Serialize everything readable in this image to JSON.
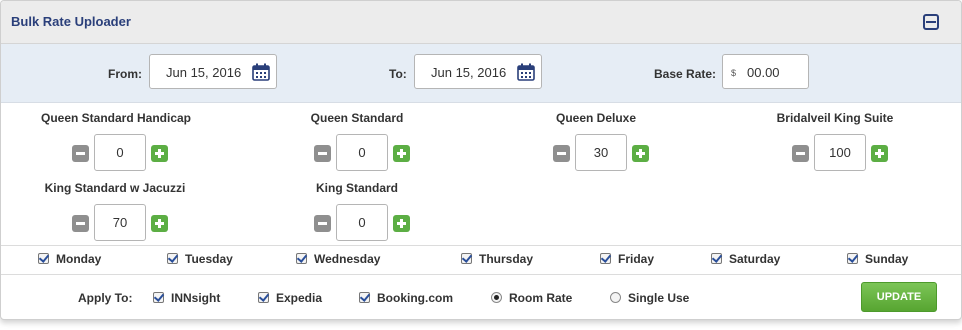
{
  "header": {
    "title": "Bulk Rate Uploader",
    "collapse_icon": "collapse-icon"
  },
  "dates": {
    "from_label": "From:",
    "from_value": "Jun 15, 2016",
    "to_label": "To:",
    "to_value": "Jun 15, 2016",
    "base_rate_label": "Base Rate:",
    "currency": "$",
    "base_rate_value": "00.00",
    "calendar_icon": "calendar-icon"
  },
  "rooms": [
    {
      "label": "Queen Standard Handicap",
      "value": "0"
    },
    {
      "label": "Queen Standard",
      "value": "0"
    },
    {
      "label": "Queen Deluxe",
      "value": "30"
    },
    {
      "label": "Bridalveil King Suite",
      "value": "100"
    },
    {
      "label": "King Standard w Jacuzzi",
      "value": "70"
    },
    {
      "label": "King Standard",
      "value": "0"
    }
  ],
  "days": [
    {
      "label": "Monday",
      "checked": true
    },
    {
      "label": "Tuesday",
      "checked": true
    },
    {
      "label": "Wednesday",
      "checked": true
    },
    {
      "label": "Thursday",
      "checked": true
    },
    {
      "label": "Friday",
      "checked": true
    },
    {
      "label": "Saturday",
      "checked": true
    },
    {
      "label": "Sunday",
      "checked": true
    }
  ],
  "apply": {
    "label": "Apply To:",
    "channels": [
      {
        "label": "INNsight",
        "checked": true
      },
      {
        "label": "Expedia",
        "checked": true
      },
      {
        "label": "Booking.com",
        "checked": true
      }
    ],
    "rate_types": [
      {
        "label": "Room Rate",
        "selected": true
      },
      {
        "label": "Single Use",
        "selected": false
      }
    ],
    "update_label": "UPDATE"
  },
  "colors": {
    "title": "#2a3f7a",
    "date_row_bg": "#e6edf5",
    "plus": "#5cae44",
    "minus": "#8f8f8f",
    "update": "#6bb845"
  }
}
